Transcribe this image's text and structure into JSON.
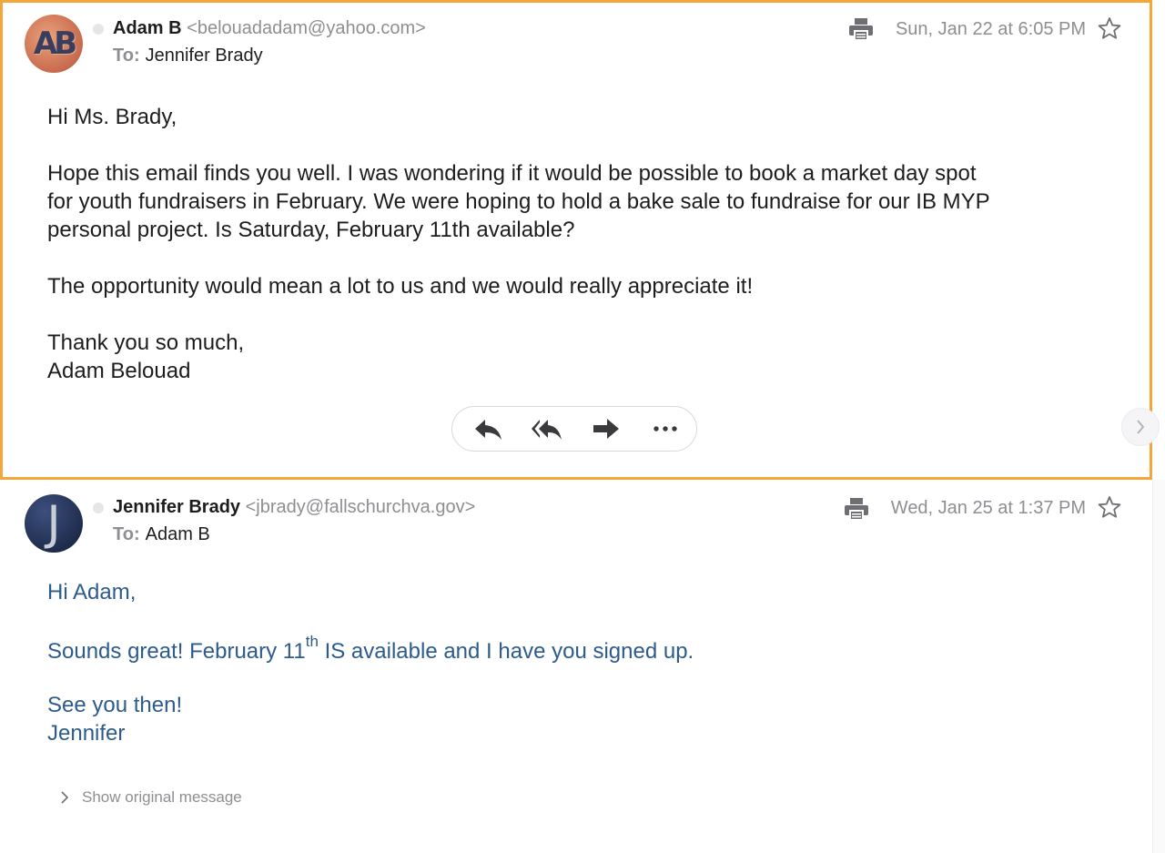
{
  "messages": [
    {
      "avatar_initials": "AB",
      "sender_name": "Adam B",
      "sender_email": "<belouadadam@yahoo.com>",
      "to_label": "To:",
      "to_name": "Jennifer Brady",
      "date": "Sun, Jan 22 at 6:05 PM",
      "body": {
        "greeting": "Hi Ms. Brady,",
        "para1_line1": "Hope this email finds you well. I was wondering if it would be possible to book a market day spot",
        "para1_line2": "for youth fundraisers in February. We were hoping to hold a bake sale to fundraise for our IB MYP",
        "para1_line3": "personal project. Is Saturday, February 11th available?",
        "para2": "The opportunity would mean a lot to us and we would really appreciate it!",
        "closing": "Thank you so much,",
        "signature": "Adam Belouad"
      }
    },
    {
      "avatar_initials": "J",
      "sender_name": "Jennifer Brady",
      "sender_email": "<jbrady@fallschurchva.gov>",
      "to_label": "To:",
      "to_name": "Adam B",
      "date": "Wed, Jan 25 at 1:37 PM",
      "body": {
        "greeting": "Hi Adam,",
        "line_pre": "Sounds great! February 11",
        "line_sup": "th",
        "line_post": " IS available and I have you signed up.",
        "closing": "See you then!",
        "signature": "Jennifer"
      },
      "show_original_label": "Show original message"
    }
  ],
  "actions": [
    "reply-icon",
    "reply-all-icon",
    "forward-icon",
    "more-icon"
  ],
  "colors": {
    "accent_border": "#f3a73a",
    "reply_text": "#2d5b8c",
    "muted": "#8e8e93"
  }
}
